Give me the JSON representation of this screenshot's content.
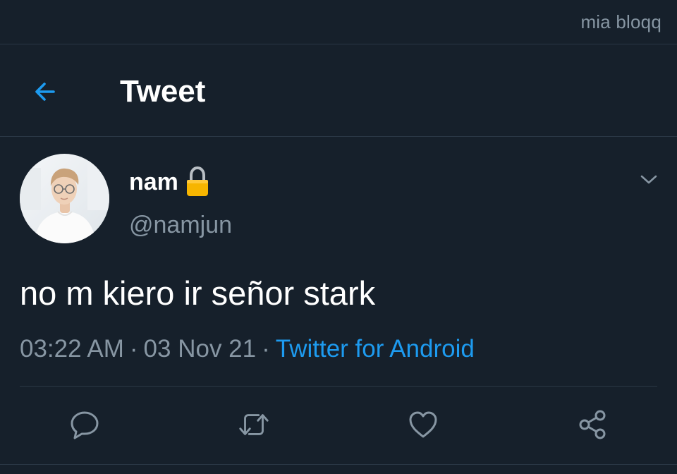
{
  "watermark": "mia bloqq",
  "header": {
    "title": "Tweet",
    "back_icon": "arrow-left-icon"
  },
  "tweet": {
    "author": {
      "name": "nam",
      "handle": "@namjun",
      "protected_icon": "lock-icon"
    },
    "text": "no m kiero ir señor stark",
    "time": "03:22 AM",
    "date": "03 Nov 21",
    "separator": "·",
    "source": "Twitter for Android"
  },
  "actions": [
    {
      "icon": "reply-icon"
    },
    {
      "icon": "retweet-icon"
    },
    {
      "icon": "like-icon"
    },
    {
      "icon": "share-icon"
    }
  ],
  "colors": {
    "background": "#16202b",
    "accent": "#1d9bf0",
    "muted": "#8796a3",
    "divider": "#2a3745"
  }
}
